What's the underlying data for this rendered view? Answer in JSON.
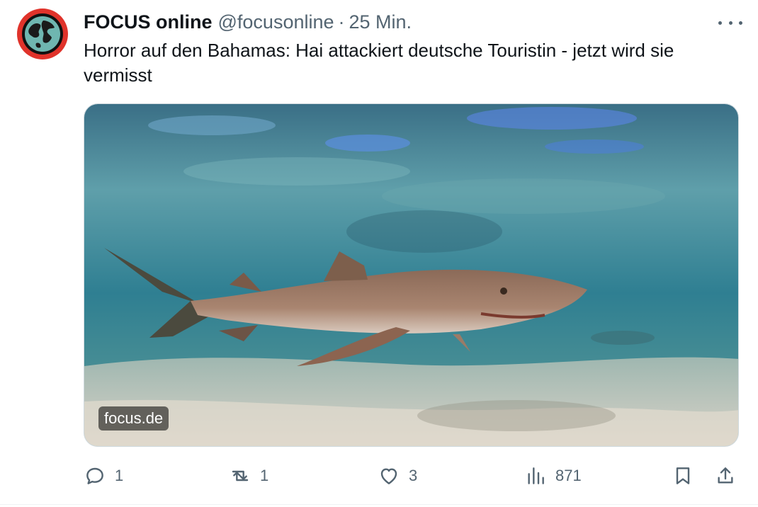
{
  "tweet": {
    "author_name": "FOCUS online",
    "handle": "@focusonline",
    "separator": "·",
    "time": "25 Min.",
    "text": "Horror auf den Bahamas: Hai attackiert deutsche Touristin - jetzt wird sie vermisst",
    "media": {
      "source_label": "focus.de"
    },
    "actions": {
      "replies": "1",
      "reposts": "1",
      "likes": "3",
      "views": "871"
    }
  },
  "icons": {
    "more": "more-icon",
    "reply": "reply-icon",
    "repost": "repost-icon",
    "like": "heart-icon",
    "views": "views-icon",
    "bookmark": "bookmark-icon",
    "share": "share-icon"
  },
  "colors": {
    "text": "#0f1419",
    "secondary": "#536471",
    "avatar_ring": "#e0332b",
    "border": "#cfd9de"
  }
}
